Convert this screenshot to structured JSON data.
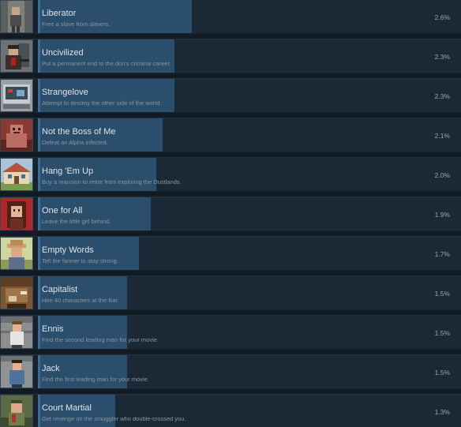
{
  "achievements": [
    {
      "title": "Liberator",
      "description": "Free a slave from slavers.",
      "percent": "2.6%",
      "icon": "liberator-icon",
      "unlock_fraction": 0.026
    },
    {
      "title": "Uncivilized",
      "description": "Put a permanent end to the don's criminal career.",
      "percent": "2.3%",
      "icon": "uncivilized-icon",
      "unlock_fraction": 0.023
    },
    {
      "title": "Strangelove",
      "description": "Attempt to destroy the other side of the world.",
      "percent": "2.3%",
      "icon": "strangelove-icon",
      "unlock_fraction": 0.023
    },
    {
      "title": "Not the Boss of Me",
      "description": "Defeat an Alpha infected.",
      "percent": "2.1%",
      "icon": "alpha-infected-icon",
      "unlock_fraction": 0.021
    },
    {
      "title": "Hang 'Em Up",
      "description": "Buy a mansion to retire from exploring the Dustlands.",
      "percent": "2.0%",
      "icon": "mansion-icon",
      "unlock_fraction": 0.02
    },
    {
      "title": "One for All",
      "description": "Leave the little girl behind.",
      "percent": "1.9%",
      "icon": "little-girl-icon",
      "unlock_fraction": 0.019
    },
    {
      "title": "Empty Words",
      "description": "Tell the farmer to stay strong.",
      "percent": "1.7%",
      "icon": "farmer-icon",
      "unlock_fraction": 0.017
    },
    {
      "title": "Capitalist",
      "description": "Hire 40 characters at the Bar.",
      "percent": "1.5%",
      "icon": "capitalist-icon",
      "unlock_fraction": 0.015
    },
    {
      "title": "Ennis",
      "description": "Find the second leading man for your movie.",
      "percent": "1.5%",
      "icon": "ennis-icon",
      "unlock_fraction": 0.015
    },
    {
      "title": "Jack",
      "description": "Find the first leading man for your movie.",
      "percent": "1.5%",
      "icon": "jack-icon",
      "unlock_fraction": 0.015
    },
    {
      "title": "Court Martial",
      "description": "Get revenge on the smuggler who double-crossed you.",
      "percent": "1.3%",
      "icon": "court-martial-icon",
      "unlock_fraction": 0.013
    }
  ],
  "colors": {
    "background": "#121a23",
    "row": "#16222e",
    "progress_fill": "#2a4e6c",
    "title": "#dfe4ea",
    "description": "#8b95a0",
    "percent": "#9aa6b2"
  }
}
